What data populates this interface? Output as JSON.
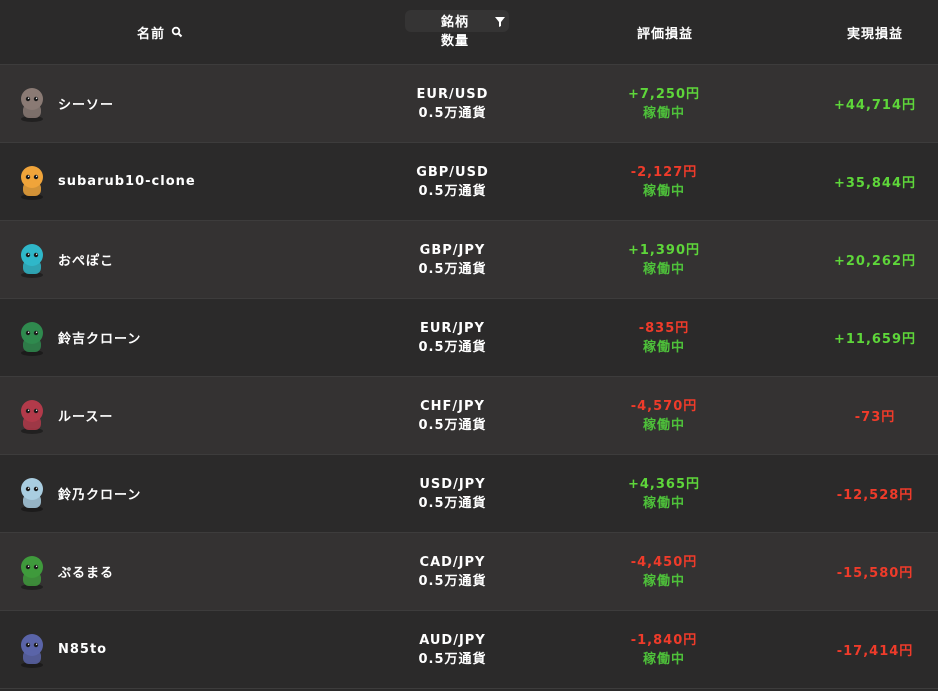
{
  "header": {
    "name_label": "名前",
    "pair_label": "銘柄",
    "qty_label": "数量",
    "eval_label": "評価損益",
    "real_label": "実現損益"
  },
  "colors": {
    "positive": "#5ed63a",
    "negative": "#ef3b2a",
    "status": "#4ec13a"
  },
  "rows": [
    {
      "name": "シーソー",
      "avatar": "alien-avatar",
      "avatar_color": "#8a7a74",
      "pair": "EUR/USD",
      "qty": "0.5万通貨",
      "eval": "+7,250円",
      "eval_sign": "pos",
      "status": "稼働中",
      "real": "+44,714円",
      "real_sign": "pos"
    },
    {
      "name": "subarub10-clone",
      "avatar": "mushroom-avatar",
      "avatar_color": "#f0a43a",
      "pair": "GBP/USD",
      "qty": "0.5万通貨",
      "eval": "-2,127円",
      "eval_sign": "neg",
      "status": "稼働中",
      "real": "+35,844円",
      "real_sign": "pos"
    },
    {
      "name": "おぺぽこ",
      "avatar": "blue-creature-avatar",
      "avatar_color": "#2fb7c9",
      "pair": "GBP/JPY",
      "qty": "0.5万通貨",
      "eval": "+1,390円",
      "eval_sign": "pos",
      "status": "稼働中",
      "real": "+20,262円",
      "real_sign": "pos"
    },
    {
      "name": "鈴吉クローン",
      "avatar": "lion-avatar",
      "avatar_color": "#2f8a4e",
      "pair": "EUR/JPY",
      "qty": "0.5万通貨",
      "eval": "-835円",
      "eval_sign": "neg",
      "status": "稼働中",
      "real": "+11,659円",
      "real_sign": "pos"
    },
    {
      "name": "ルースー",
      "avatar": "red-creature-avatar",
      "avatar_color": "#b23a4a",
      "pair": "CHF/JPY",
      "qty": "0.5万通貨",
      "eval": "-4,570円",
      "eval_sign": "neg",
      "status": "稼働中",
      "real": "-73円",
      "real_sign": "neg"
    },
    {
      "name": "鈴乃クローン",
      "avatar": "cloud-creature-avatar",
      "avatar_color": "#a9cde0",
      "pair": "USD/JPY",
      "qty": "0.5万通貨",
      "eval": "+4,365円",
      "eval_sign": "pos",
      "status": "稼働中",
      "real": "-12,528円",
      "real_sign": "neg"
    },
    {
      "name": "ぷるまる",
      "avatar": "green-creature-avatar",
      "avatar_color": "#3f9a3c",
      "pair": "CAD/JPY",
      "qty": "0.5万通貨",
      "eval": "-4,450円",
      "eval_sign": "neg",
      "status": "稼働中",
      "real": "-15,580円",
      "real_sign": "neg"
    },
    {
      "name": "N85to",
      "avatar": "wolf-avatar",
      "avatar_color": "#5a64a8",
      "pair": "AUD/JPY",
      "qty": "0.5万通貨",
      "eval": "-1,840円",
      "eval_sign": "neg",
      "status": "稼働中",
      "real": "-17,414円",
      "real_sign": "neg"
    }
  ]
}
